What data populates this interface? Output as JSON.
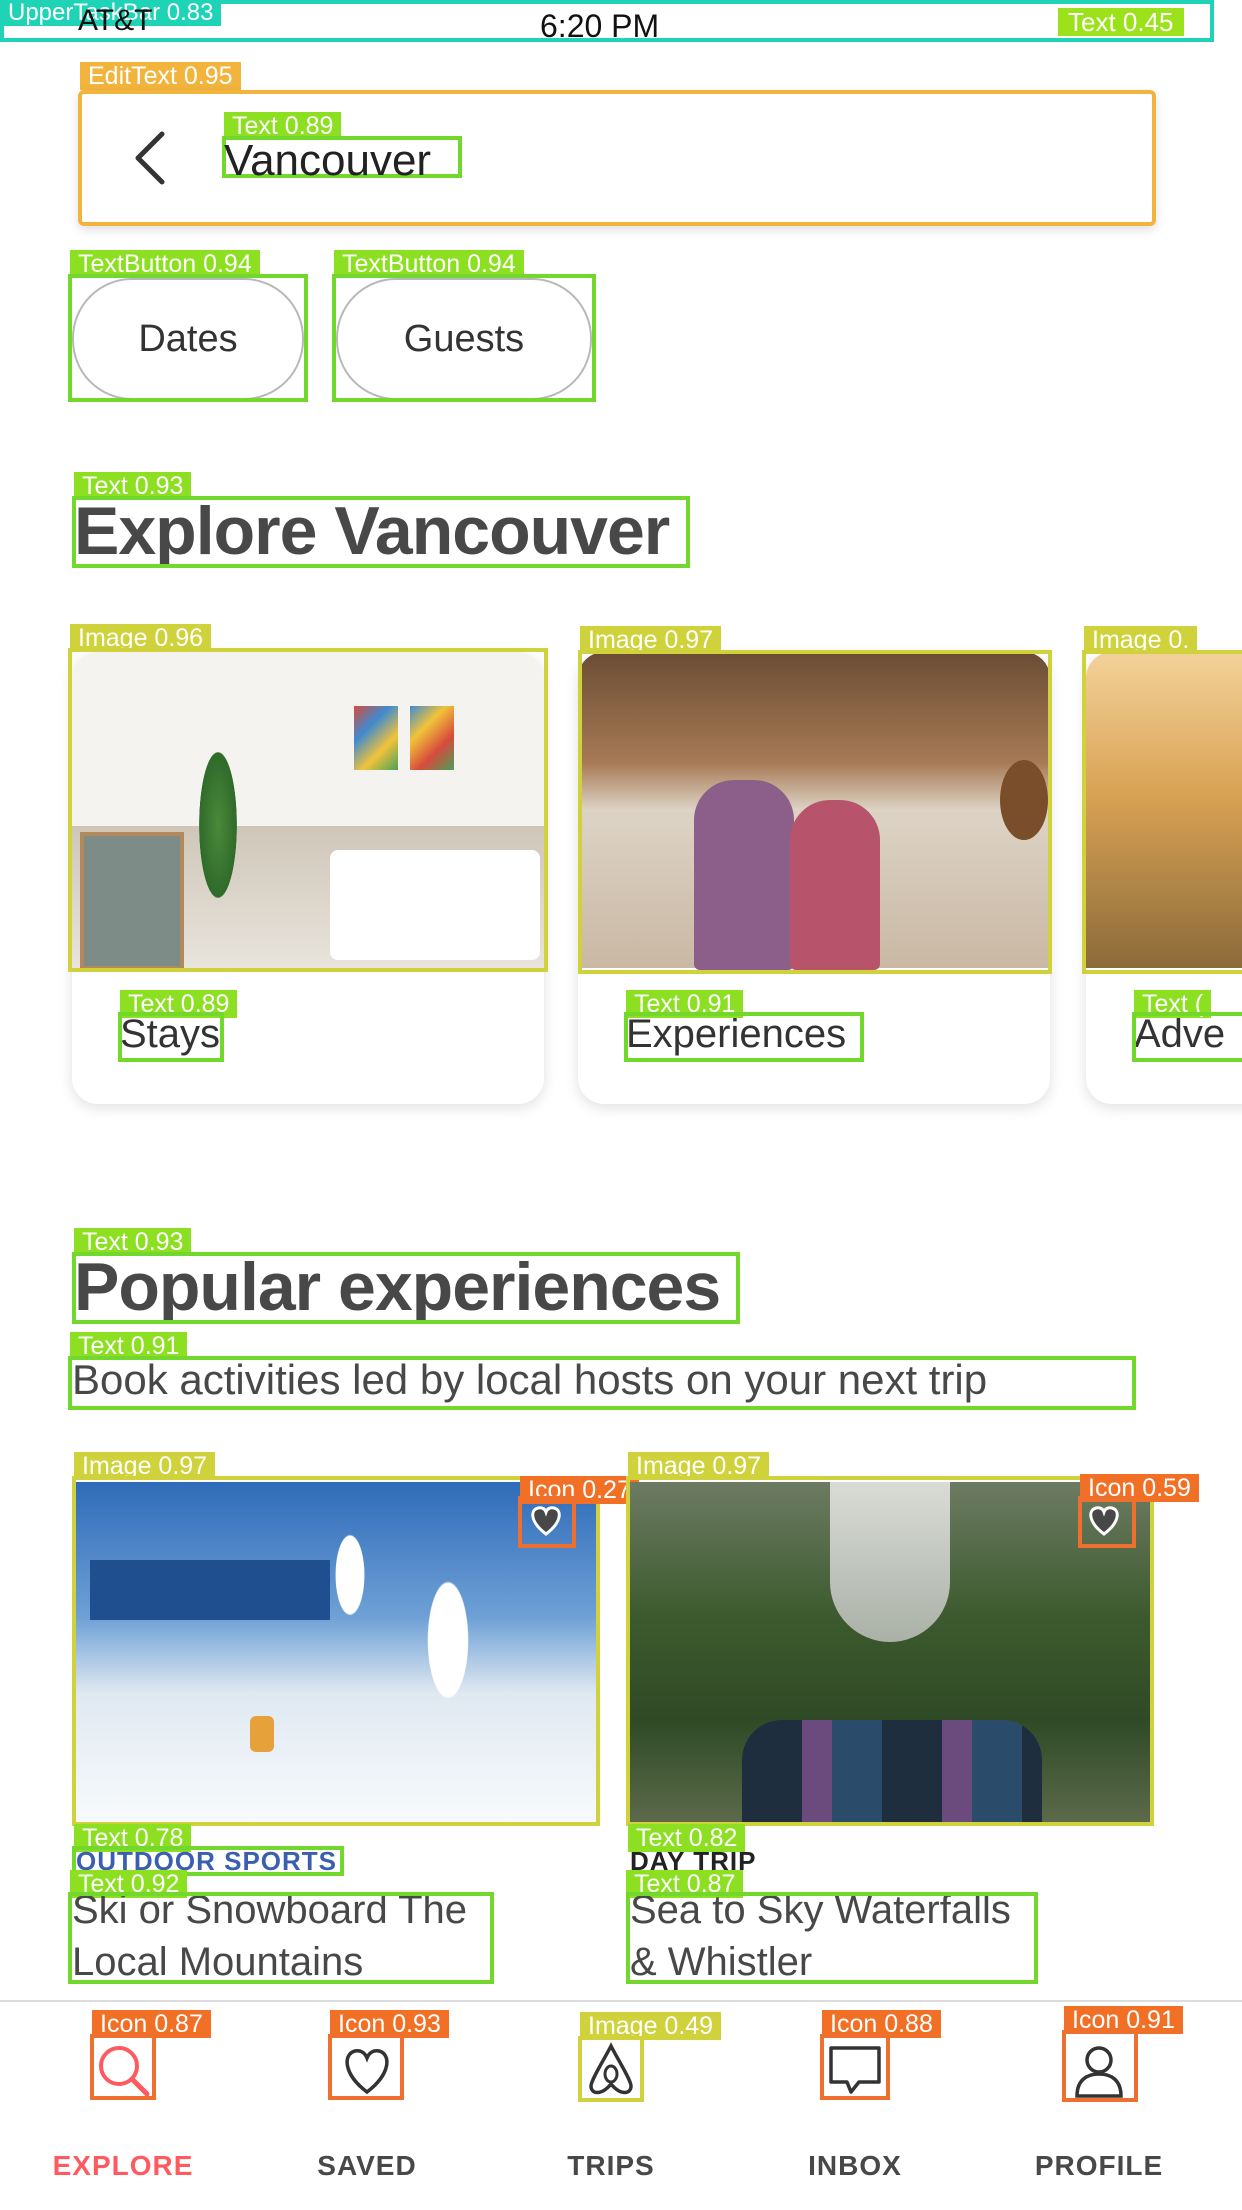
{
  "status_bar": {
    "detection_label": "UpperTaskBar 0.83",
    "carrier": "AT&T",
    "time": "6:20 PM",
    "battery_detection_label": "Text 0.45"
  },
  "search": {
    "detection_label": "EditText 0.95",
    "value_detection_label": "Text 0.89",
    "value": "Vancouver"
  },
  "filters": [
    {
      "label": "Dates",
      "detection_label": "TextButton 0.94"
    },
    {
      "label": "Guests",
      "detection_label": "TextButton 0.94"
    }
  ],
  "explore": {
    "title": "Explore Vancouver",
    "title_detection_label": "Text 0.93",
    "cards": [
      {
        "label": "Stays",
        "image_detection_label": "Image 0.96",
        "text_detection_label": "Text 0.89"
      },
      {
        "label": "Experiences",
        "image_detection_label": "Image 0.97",
        "text_detection_label": "Text 0.91"
      },
      {
        "label": "Adve",
        "image_detection_label": "Image 0.",
        "text_detection_label": "Text ("
      }
    ]
  },
  "popular": {
    "title": "Popular experiences",
    "title_detection_label": "Text 0.93",
    "subtitle": "Book activities led by local hosts on your next trip",
    "subtitle_detection_label": "Text 0.91",
    "items": [
      {
        "kicker": "OUTDOOR SPORTS",
        "kicker_color": "#3a5fb0",
        "kicker_detection_label": "Text 0.78",
        "title_line1": "Ski or Snowboard The",
        "title_line2": "Local Mountains",
        "title_detection_label": "Text 0.92",
        "image_detection_label": "Image 0.97",
        "heart_detection_label": "Icon 0.27"
      },
      {
        "kicker": "DAY TRIP",
        "kicker_color": "#222222",
        "kicker_detection_label": "Text 0.82",
        "title_line1": "Sea to Sky Waterfalls",
        "title_line2": "& Whistler",
        "title_detection_label": "Text 0.87",
        "image_detection_label": "Image 0.97",
        "heart_detection_label": "Icon 0.59"
      }
    ]
  },
  "nav": [
    {
      "label": "EXPLORE",
      "icon": "search-icon",
      "detection_label": "Icon 0.87",
      "active": true
    },
    {
      "label": "SAVED",
      "icon": "heart-icon",
      "detection_label": "Icon 0.93",
      "active": false
    },
    {
      "label": "TRIPS",
      "icon": "airbnb-logo-icon",
      "detection_label": "Image 0.49",
      "active": false
    },
    {
      "label": "INBOX",
      "icon": "chat-bubble-icon",
      "detection_label": "Icon 0.88",
      "active": false
    },
    {
      "label": "PROFILE",
      "icon": "person-icon",
      "detection_label": "Icon 0.91",
      "active": false
    }
  ],
  "colors": {
    "accent": "#ff5a5f",
    "text_box": "#72d92c",
    "image_box": "#cfd23a",
    "icon_box": "#ef6f2e",
    "edit_box": "#f2b43c",
    "taskbar_box": "#1fd3b6"
  }
}
